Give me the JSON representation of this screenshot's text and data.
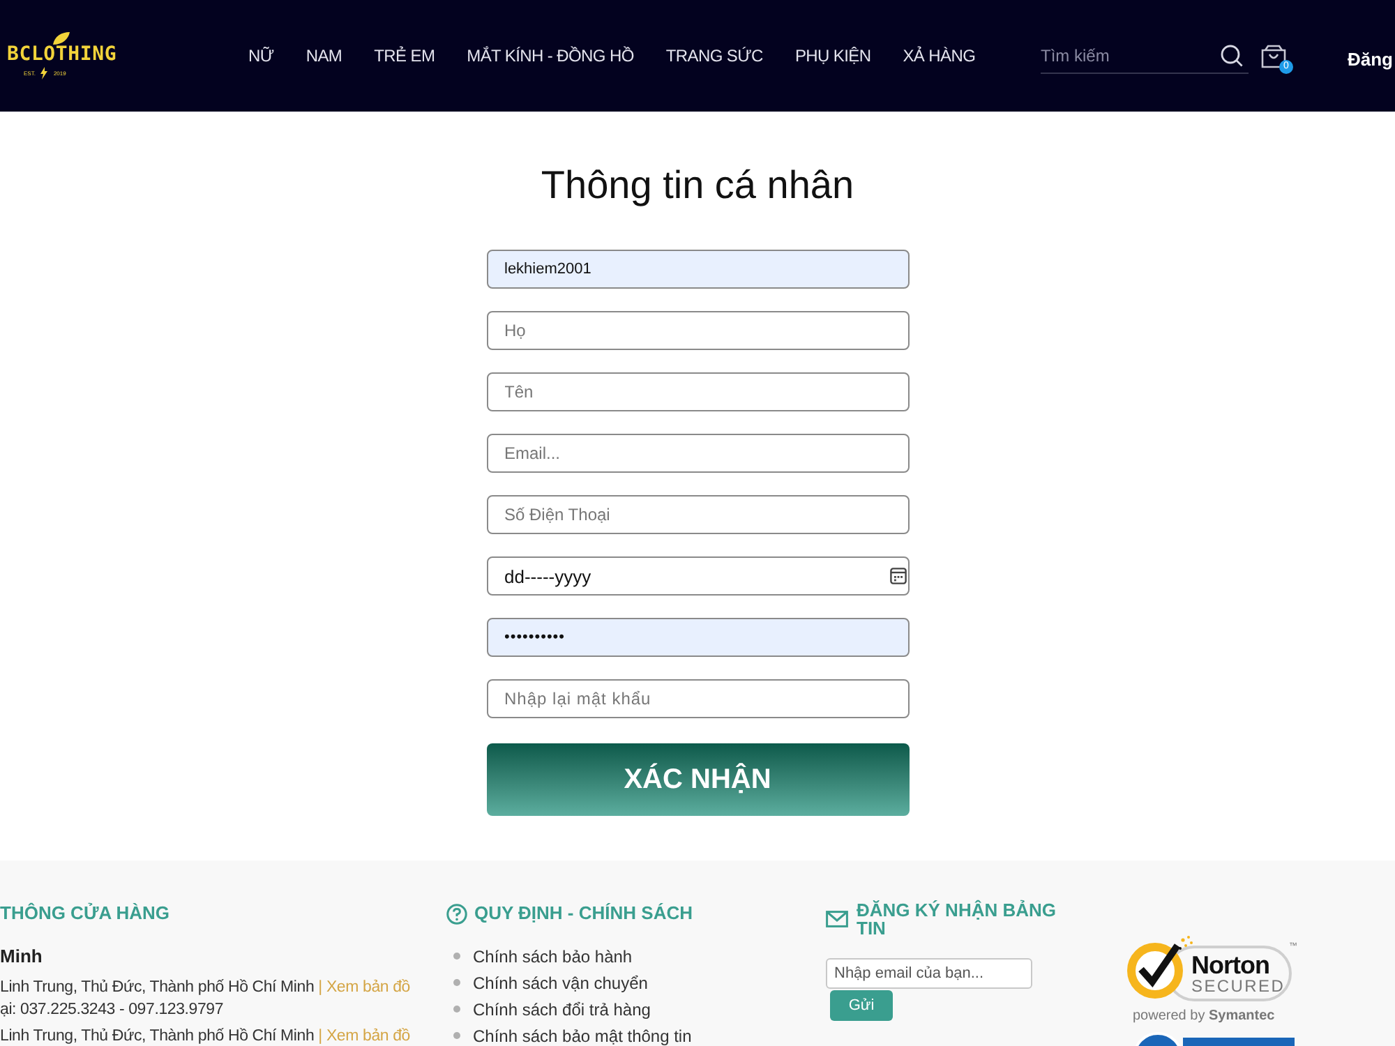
{
  "header": {
    "logo": {
      "name": "BCLOTHING",
      "est": "EST.",
      "year": "2019"
    },
    "nav": [
      "NỮ",
      "NAM",
      "TRẺ EM",
      "MẮT KÍNH - ĐỒNG HỒ",
      "TRANG SỨC",
      "PHỤ KIỆN",
      "XẢ HÀNG"
    ],
    "search": {
      "placeholder": "Tìm kiếm"
    },
    "cart": {
      "count": "0"
    },
    "account_link": "Đăng"
  },
  "form": {
    "title": "Thông tin cá nhân",
    "fields": [
      {
        "kind": "text",
        "value": "lekhiem2001",
        "autofilled": true
      },
      {
        "kind": "text",
        "placeholder": "Họ",
        "autofilled": false
      },
      {
        "kind": "text",
        "placeholder": "Tên",
        "autofilled": false
      },
      {
        "kind": "text",
        "placeholder": "Email...",
        "autofilled": false
      },
      {
        "kind": "text",
        "placeholder": "Số Điện Thoại",
        "autofilled": false
      },
      {
        "kind": "date",
        "value": "dd-----yyyy",
        "autofilled": false
      },
      {
        "kind": "password",
        "value": "••••••••••",
        "autofilled": true
      },
      {
        "kind": "password",
        "placeholder": "Nhập lại mật khẩu",
        "autofilled": false
      }
    ],
    "submit": "XÁC NHẬN"
  },
  "footer": {
    "store_info": {
      "title": "THÔNG CỬA HÀNG",
      "lines": [
        {
          "kind": "name",
          "text": "Minh"
        },
        {
          "kind": "address",
          "text": "Linh Trung, Thủ Đức, Thành phố Hồ Chí Minh",
          "link": "| Xem bản đồ"
        },
        {
          "kind": "phone",
          "text": "ại: 037.225.3243 - 097.123.9797"
        },
        {
          "kind": "address",
          "text": "Linh Trung, Thủ Đức, Thành phố Hồ Chí Minh",
          "link": "| Xem bản đồ"
        }
      ]
    },
    "policies": {
      "title": "QUY ĐỊNH - CHÍNH SÁCH",
      "items": [
        "Chính sách bảo hành",
        "Chính sách vận chuyển",
        "Chính sách đổi trả hàng",
        "Chính sách bảo mật thông tin"
      ]
    },
    "newsletter": {
      "title": "ĐĂNG KÝ NHẬN BẢNG TIN",
      "placeholder": "Nhập email của bạn...",
      "button": "Gửi"
    },
    "norton": {
      "brand": "Norton",
      "label": "SECURED",
      "mark": "™",
      "powered_by": "powered by **Symantec**"
    }
  }
}
